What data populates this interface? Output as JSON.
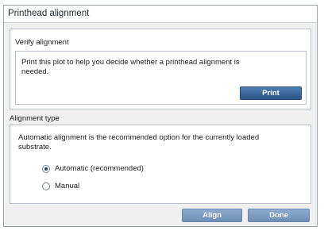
{
  "window": {
    "title": "Printhead alignment"
  },
  "verify": {
    "heading": "Verify alignment",
    "description_line1": "Print this plot to help you decide whether a printhead alignment is",
    "description_line2": "needed.",
    "print_label": "Print"
  },
  "alignment": {
    "heading": "Alignment type",
    "description_line1": "Automatic alignment is the recommended option for the currently loaded",
    "description_line2": "substrate.",
    "options": [
      {
        "label": "Automatic (recommended)",
        "selected": true
      },
      {
        "label": "Manual",
        "selected": false
      }
    ]
  },
  "footer": {
    "align_label": "Align",
    "done_label": "Done"
  }
}
